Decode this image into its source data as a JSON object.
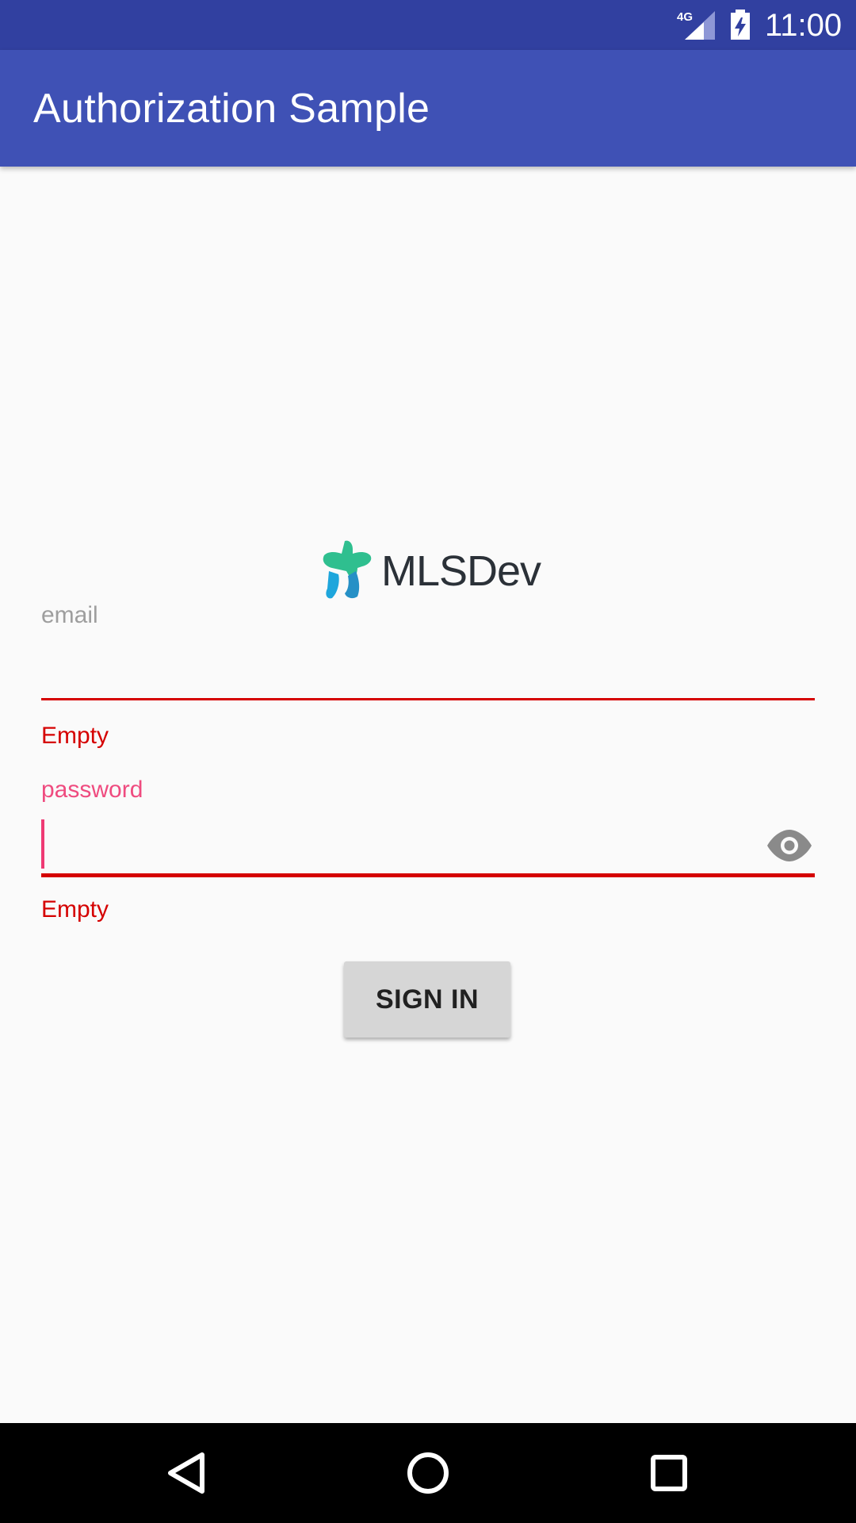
{
  "status_bar": {
    "network": "4G",
    "time": "11:00"
  },
  "app_bar": {
    "title": "Authorization Sample"
  },
  "logo": {
    "text": "MLSDev",
    "colors": {
      "teal": "#2fbf8f",
      "blue": "#1ea6dc",
      "text": "#2b3138"
    }
  },
  "form": {
    "email": {
      "label": "email",
      "value": "",
      "error": "Empty"
    },
    "password": {
      "label": "password",
      "value": "",
      "error": "Empty",
      "toggle_icon": "eye-icon"
    },
    "sign_in_label": "SIGN IN"
  },
  "colors": {
    "status_bar": "#3140a0",
    "primary": "#3f51b5",
    "accent": "#ef4b7f",
    "error": "#d50000",
    "background": "#fafafa"
  },
  "nav_bar": {
    "icons": [
      "back-icon",
      "home-icon",
      "recents-icon"
    ]
  }
}
